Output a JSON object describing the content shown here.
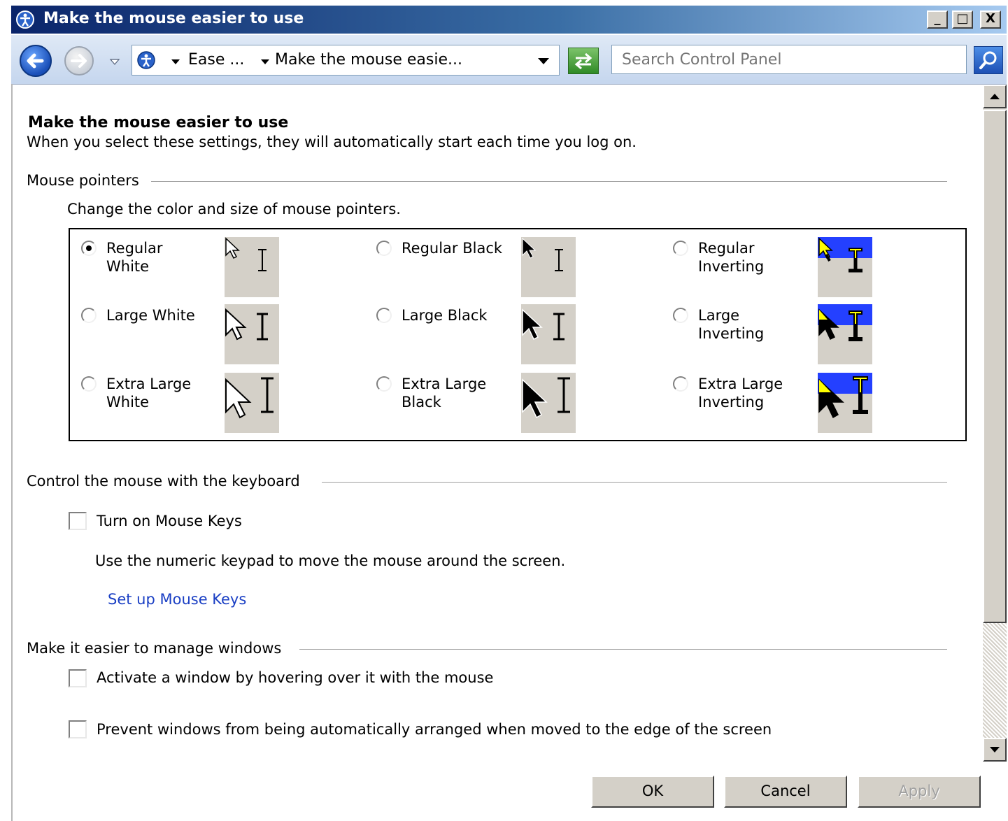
{
  "window": {
    "title": "Make the mouse easier to use",
    "minimize_label": "_",
    "maximize_label": "□",
    "close_label": "X"
  },
  "address_bar": {
    "breadcrumbs": [
      "Ease ...",
      "Make the mouse easie..."
    ],
    "search_placeholder": "Search Control Panel"
  },
  "page": {
    "title": "Make the mouse easier to use",
    "subtitle": "When you select these settings, they will automatically start each time you log on."
  },
  "mouse_pointers": {
    "heading": "Mouse pointers",
    "description": "Change the color and size of mouse pointers.",
    "options": [
      {
        "label": "Regular\nWhite",
        "selected": true
      },
      {
        "label": "Regular Black",
        "selected": false
      },
      {
        "label": "Regular\nInverting",
        "selected": false
      },
      {
        "label": "Large White",
        "selected": false
      },
      {
        "label": "Large Black",
        "selected": false
      },
      {
        "label": "Large\nInverting",
        "selected": false
      },
      {
        "label": "Extra Large\nWhite",
        "selected": false
      },
      {
        "label": "Extra Large\nBlack",
        "selected": false
      },
      {
        "label": "Extra Large\nInverting",
        "selected": false
      }
    ]
  },
  "keyboard_control": {
    "heading": "Control the mouse with the keyboard",
    "mouse_keys_label": "Turn on Mouse Keys",
    "mouse_keys_checked": false,
    "mouse_keys_description": "Use the numeric keypad to move the mouse around the screen.",
    "setup_link": "Set up Mouse Keys"
  },
  "windows_management": {
    "heading": "Make it easier to manage windows",
    "hover_activate_label": "Activate a window by hovering over it with the mouse",
    "hover_activate_checked": false,
    "prevent_arrange_label": "Prevent windows from being automatically arranged when moved to the edge of the screen",
    "prevent_arrange_checked": false
  },
  "buttons": {
    "ok": "OK",
    "cancel": "Cancel",
    "apply": "Apply"
  },
  "colors": {
    "titlebar_start": "#0a246a",
    "inverting_band": "#2440ff",
    "inverting_arrow": "#ffff00",
    "link": "#1a3fc4",
    "button_face": "#d4d0c8"
  }
}
